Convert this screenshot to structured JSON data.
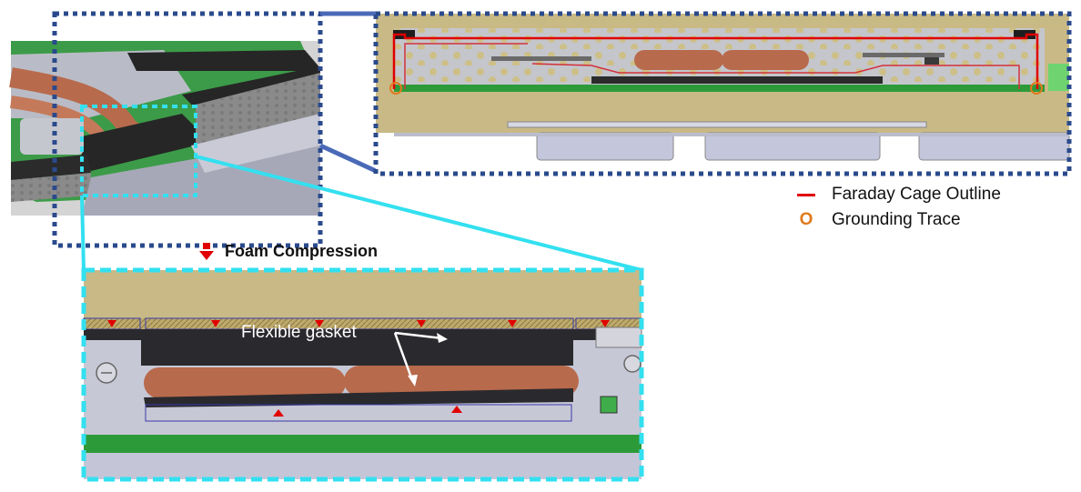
{
  "legend": {
    "faraday_label": "Faraday Cage Outline",
    "grounding_label": "Grounding Trace",
    "grounding_symbol": "O",
    "faraday_color": "#e00000",
    "grounding_color": "#e07a1c"
  },
  "annotations": {
    "foam_compression": "Foam Compression",
    "flexible_gasket": "Flexible gasket"
  },
  "colors": {
    "callout_top": "#2a4a8c",
    "callout_bottom": "#33e0f0",
    "pcb_green": "#2d9a3a",
    "copper": "#b86a4c",
    "chassis_tan": "#c8b987"
  }
}
